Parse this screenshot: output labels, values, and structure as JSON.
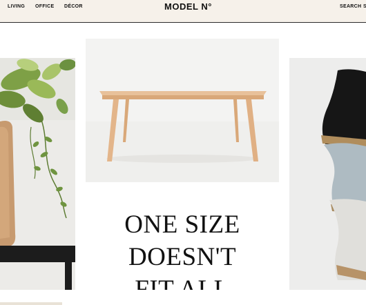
{
  "header": {
    "logo": "MODEL N°",
    "nav_left": [
      "LIVING",
      "OFFICE",
      "DÉCOR"
    ],
    "nav_right": [
      "SEARCH",
      "S"
    ]
  },
  "panels": {
    "left": {
      "subject": "plant-in-vase-on-stool"
    },
    "center": {
      "subject": "wooden-dining-table"
    },
    "right": {
      "subject": "stacked-vases"
    }
  },
  "headline": {
    "lines": [
      "ONE SIZE",
      "DOESN'T",
      "FIT ALL"
    ]
  },
  "colors": {
    "header_bg": "#f6f1ea",
    "text": "#111111",
    "wood": "#e3b58a"
  }
}
